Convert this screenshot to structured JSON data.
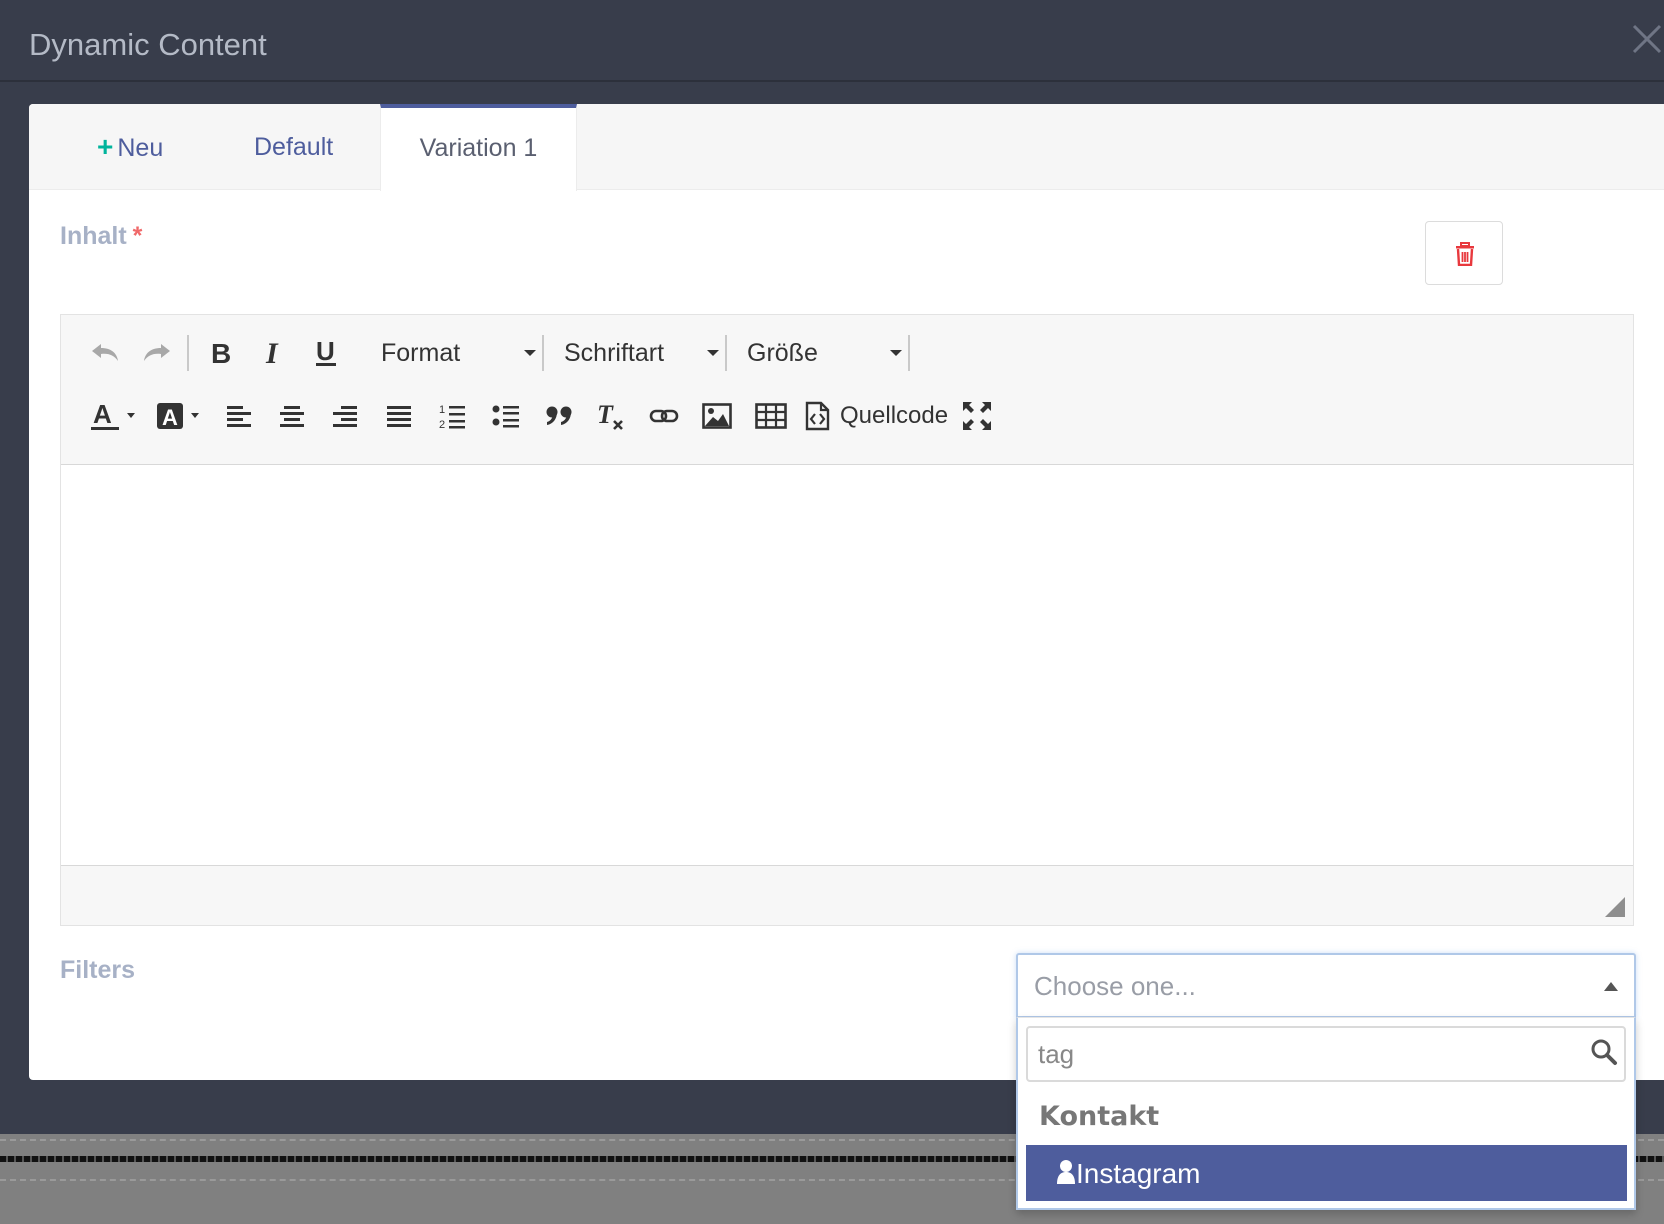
{
  "modal": {
    "title": "Dynamic Content"
  },
  "tabs": {
    "new_label": "Neu",
    "new_plus": "+",
    "default_label": "Default",
    "active_label": "Variation 1"
  },
  "content": {
    "label": "Inhalt",
    "required_mark": "*"
  },
  "editor": {
    "format_label": "Format",
    "font_label": "Schriftart",
    "size_label": "Größe",
    "source_label": "Quellcode"
  },
  "filters": {
    "label": "Filters",
    "select_placeholder": "Choose one...",
    "search_value": "tag",
    "group_label": "Kontakt",
    "highlighted_option": "Instagram"
  },
  "colors": {
    "accent": "#4e5d9d",
    "add_green": "#00b49c",
    "delete_red": "#e8383d",
    "label_gray": "#a7b1c6"
  }
}
